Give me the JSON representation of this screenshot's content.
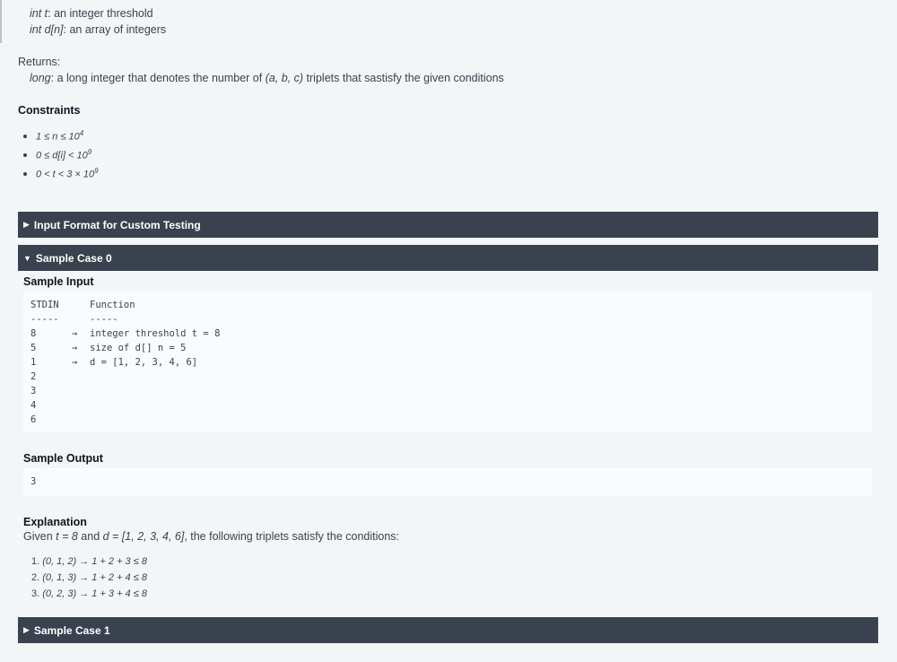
{
  "params": [
    {
      "name": "int t",
      "desc": ": an integer threshold"
    },
    {
      "name": "int d[n]",
      "desc": ": an array of integers"
    }
  ],
  "returns": {
    "label": "Returns:",
    "type": "long",
    "desc_pre": ": a long integer that denotes the number of ",
    "tuple": "(a, b, c)",
    "desc_post": " triplets that sastisfy the given conditions"
  },
  "constraints": {
    "title": "Constraints",
    "items": [
      {
        "text": "1 ≤ n ≤ 10",
        "sup": "4"
      },
      {
        "text": "0 ≤ d[i] < 10",
        "sup": "9"
      },
      {
        "text": "0 < t < 3 × 10",
        "sup": "9"
      }
    ]
  },
  "sections": {
    "input_format": {
      "arrow": "▶",
      "label": "Input Format for Custom Testing"
    },
    "sample0": {
      "arrow": "▼",
      "label": "Sample Case 0"
    },
    "sample1": {
      "arrow": "▶",
      "label": "Sample Case 1"
    }
  },
  "sample_input": {
    "title": "Sample Input",
    "header": [
      "STDIN",
      "Function"
    ],
    "divider": [
      "-----",
      "-----"
    ],
    "rows": [
      {
        "stdin": "8",
        "arrow": "→",
        "fn": "integer threshold t = 8"
      },
      {
        "stdin": "5",
        "arrow": "→",
        "fn": "size of d[] n = 5"
      },
      {
        "stdin": "1",
        "arrow": "→",
        "fn": "d = [1, 2, 3, 4, 6]"
      },
      {
        "stdin": "2",
        "arrow": "",
        "fn": ""
      },
      {
        "stdin": "3",
        "arrow": "",
        "fn": ""
      },
      {
        "stdin": "4",
        "arrow": "",
        "fn": ""
      },
      {
        "stdin": "6",
        "arrow": "",
        "fn": ""
      }
    ]
  },
  "sample_output": {
    "title": "Sample Output",
    "value": "3"
  },
  "explanation": {
    "title": "Explanation",
    "given": "Given ",
    "t_expr": "t = 8",
    "and": " and ",
    "d_expr": "d = [1, 2, 3, 4, 6]",
    "rest": ", the following triplets satisfy the conditions:",
    "items": [
      {
        "num": "1. ",
        "triplet": "(0, 1, 2) → 1 + 2 + 3 ≤ 8"
      },
      {
        "num": "2. ",
        "triplet": "(0, 1, 3) → 1 + 2 + 4 ≤ 8"
      },
      {
        "num": "3. ",
        "triplet": "(0, 2, 3) → 1 + 3 + 4 ≤ 8"
      }
    ]
  }
}
